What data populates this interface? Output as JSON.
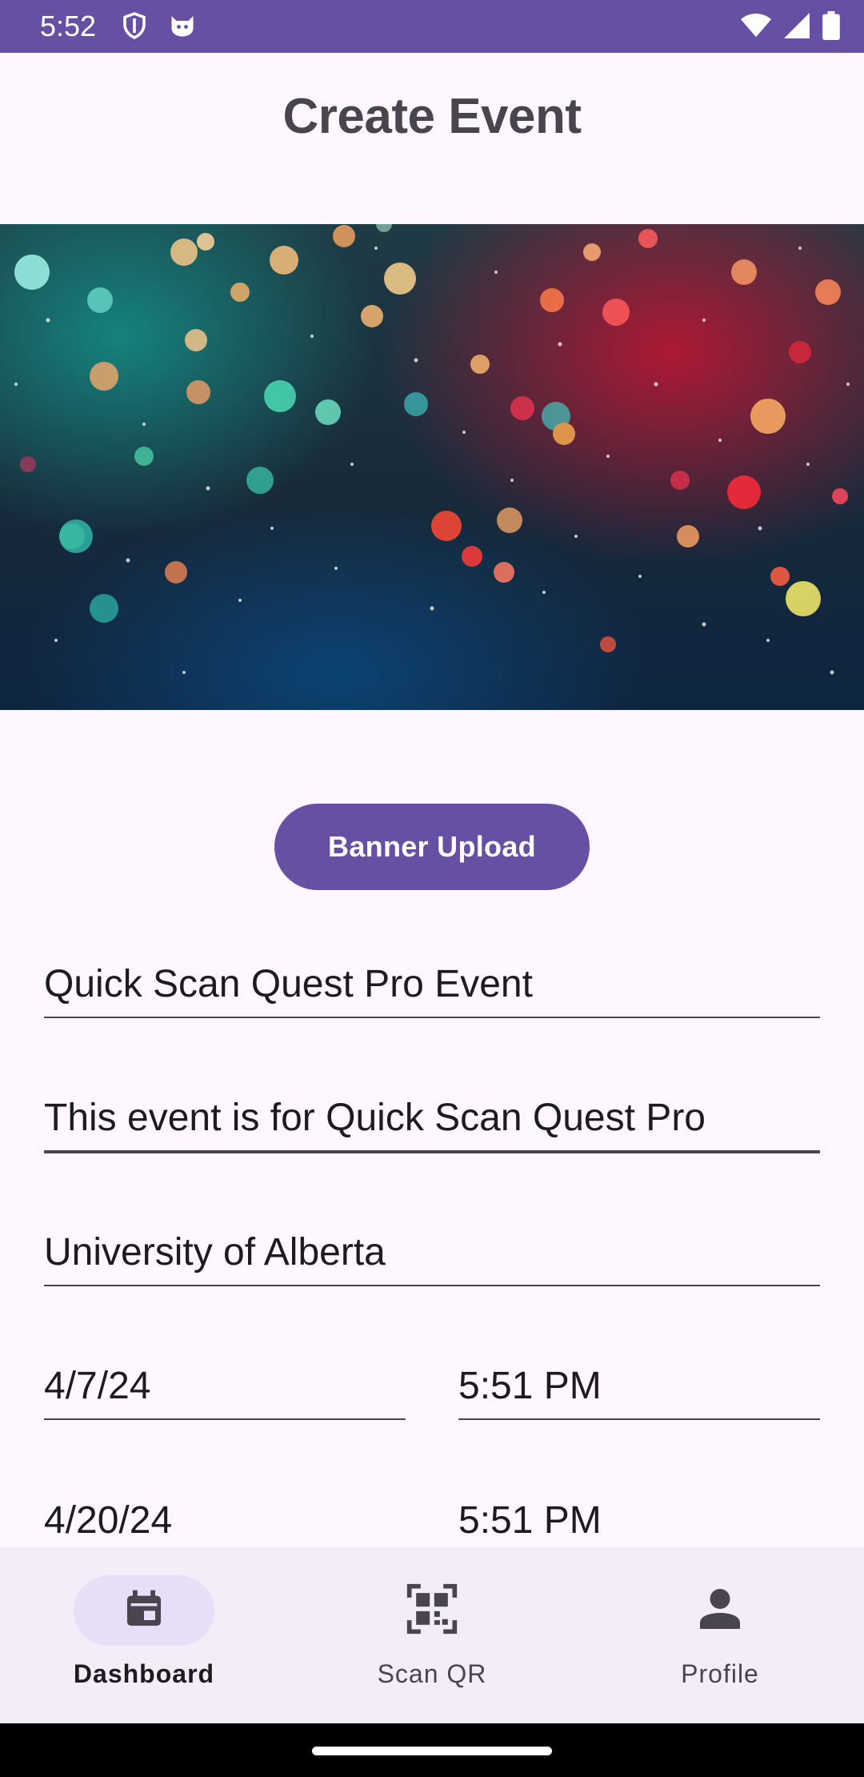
{
  "status_bar": {
    "time": "5:52",
    "left_icons": [
      "shield-icon",
      "cat-icon"
    ],
    "right_icons": [
      "wifi-icon",
      "signal-icon",
      "battery-icon"
    ],
    "color": "#6750a4"
  },
  "page": {
    "title": "Create Event"
  },
  "banner": {
    "description_icon": "bokeh-lights-image"
  },
  "actions": {
    "banner_upload_label": "Banner Upload"
  },
  "form": {
    "event_name": "Quick Scan Quest Pro Event",
    "event_description": "This event is for Quick Scan Quest Pro",
    "event_location": "University of Alberta",
    "start_date": "4/7/24",
    "start_time": "5:51 PM",
    "end_date": "4/20/24",
    "end_time": "5:51 PM"
  },
  "bottom_nav": {
    "items": [
      {
        "label": "Dashboard",
        "icon": "calendar-icon",
        "active": true
      },
      {
        "label": "Scan QR",
        "icon": "qr-scan-icon",
        "active": false
      },
      {
        "label": "Profile",
        "icon": "person-icon",
        "active": false
      }
    ]
  },
  "colors": {
    "accent": "#6750a4",
    "background": "#fef7ff",
    "nav_background": "#f3edf7",
    "active_pill": "#e8def8"
  }
}
